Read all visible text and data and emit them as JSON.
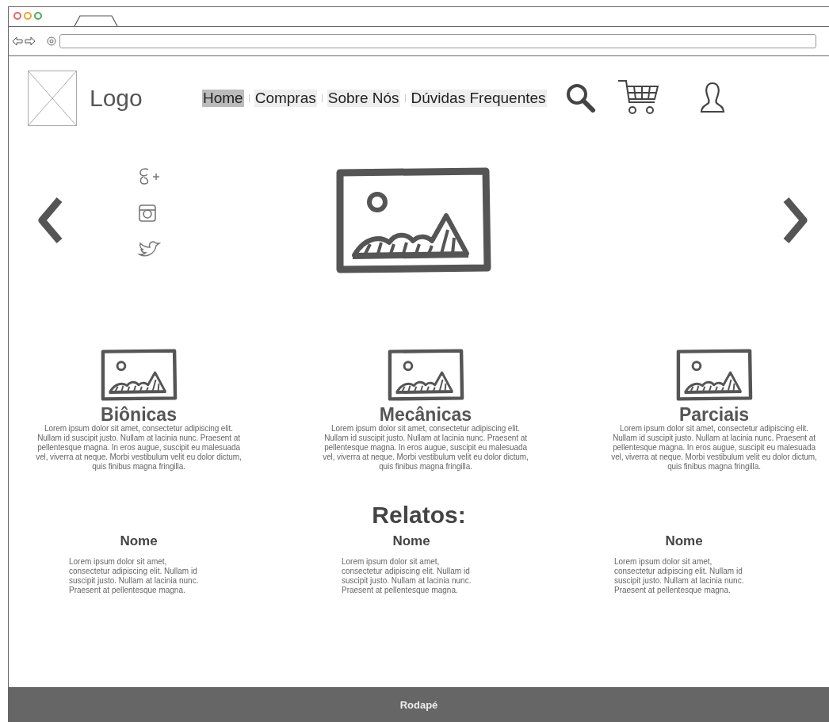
{
  "browser": {
    "title_bar": {
      "window_buttons": [
        {
          "color": "#e06666"
        },
        {
          "color": "#f0a030"
        },
        {
          "color": "#4caf50"
        }
      ]
    }
  },
  "header": {
    "logo": "Logo",
    "nav": [
      {
        "label": "Home",
        "selected": true
      },
      {
        "label": "Compras",
        "selected": false
      },
      {
        "label": "Sobre Nós",
        "selected": false
      },
      {
        "label": "Dúvidas Frequentes",
        "selected": false
      }
    ]
  },
  "categories": [
    {
      "title": "Biônicas",
      "text": "Lorem ipsum dolor sit amet, consectetur adipiscing elit. Nullam id suscipit justo. Nullam at lacinia nunc. Praesent at pellentesque magna. In eros augue, suscipit eu malesuada vel, viverra at neque. Morbi vestibulum velit eu dolor dictum, quis finibus magna fringilla."
    },
    {
      "title": "Mecânicas",
      "text": "Lorem ipsum dolor sit amet, consectetur adipiscing elit. Nullam id suscipit justo. Nullam at lacinia nunc. Praesent at pellentesque magna. In eros augue, suscipit eu malesuada vel, viverra at neque. Morbi vestibulum velit eu dolor dictum, quis finibus magna fringilla."
    },
    {
      "title": "Parciais",
      "text": "Lorem ipsum dolor sit amet, consectetur adipiscing elit. Nullam id suscipit justo. Nullam at lacinia nunc. Praesent at pellentesque magna. In eros augue, suscipit eu malesuada vel, viverra at neque. Morbi vestibulum velit eu dolor dictum, quis finibus magna fringilla."
    }
  ],
  "testimonials": {
    "title": "Relatos:",
    "items": [
      {
        "name": "Nome",
        "text": "Lorem ipsum dolor sit amet, consectetur adipiscing elit. Nullam id suscipit justo. Nullam at lacinia nunc. Praesent at pellentesque magna."
      },
      {
        "name": "Nome",
        "text": "Lorem ipsum dolor sit amet, consectetur adipiscing elit. Nullam id suscipit justo. Nullam at lacinia nunc. Praesent at pellentesque magna."
      },
      {
        "name": "Nome",
        "text": "Lorem ipsum dolor sit amet, consectetur adipiscing elit. Nullam id suscipit justo. Nullam at lacinia nunc. Praesent at pellentesque magna."
      }
    ]
  },
  "footer": {
    "text": "Rodapé"
  }
}
